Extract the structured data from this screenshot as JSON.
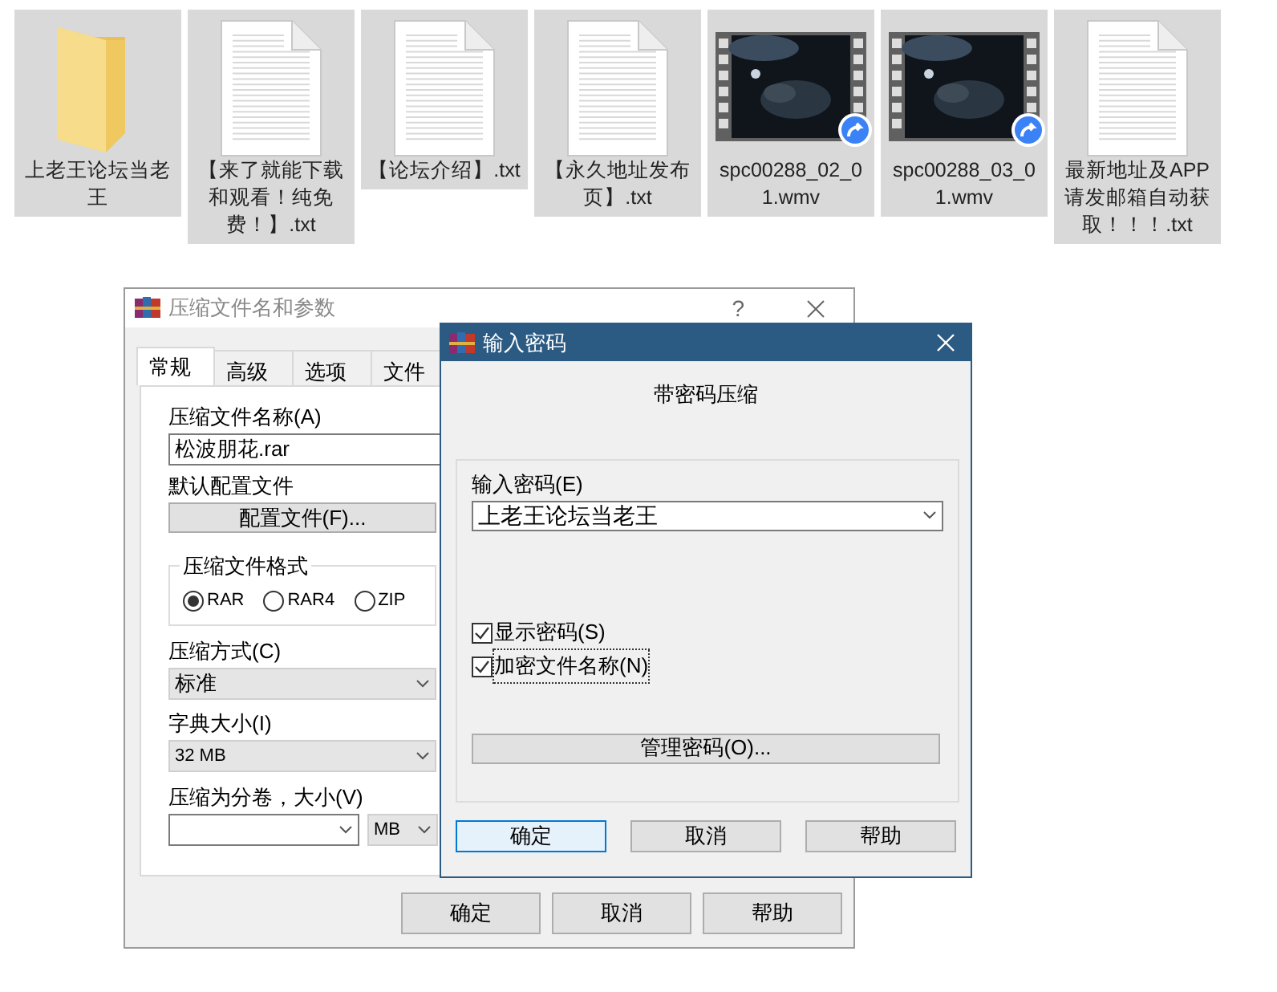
{
  "files": [
    {
      "kind": "folder",
      "name_lines": [
        "上老王论坛当老",
        "王"
      ]
    },
    {
      "kind": "text",
      "name_lines": [
        "【来了就能下载",
        "和观看！纯免",
        "费！】.txt"
      ]
    },
    {
      "kind": "text",
      "name_lines": [
        "【论坛介绍】.txt"
      ]
    },
    {
      "kind": "text",
      "name_lines": [
        "【永久地址发布",
        "页】.txt"
      ]
    },
    {
      "kind": "video",
      "name_lines": [
        "spc00288_02_0",
        "1.wmv"
      ]
    },
    {
      "kind": "video",
      "name_lines": [
        "spc00288_03_0",
        "1.wmv"
      ]
    },
    {
      "kind": "text",
      "name_lines": [
        "最新地址及APP",
        "请发邮箱自动获",
        "取！！！.txt"
      ]
    }
  ],
  "archive_dialog": {
    "title": "压缩文件名和参数",
    "help": "?",
    "tabs": [
      {
        "label": "常规",
        "selected": true
      },
      {
        "label": "高级",
        "selected": false
      },
      {
        "label": "选项",
        "selected": false
      },
      {
        "label": "文件",
        "selected": false
      }
    ],
    "name_label": "压缩文件名称(A)",
    "name_value": "松波朋花.rar",
    "profile_label": "默认配置文件",
    "profile_button": "配置文件(F)...",
    "format_group": "压缩文件格式",
    "formats": [
      {
        "label": "RAR",
        "selected": true
      },
      {
        "label": "RAR4",
        "selected": false
      },
      {
        "label": "ZIP",
        "selected": false
      }
    ],
    "method_label": "压缩方式(C)",
    "method_value": "标准",
    "dict_label": "字典大小(I)",
    "dict_value": "32 MB",
    "volume_label": "压缩为分卷，大小(V)",
    "volume_unit": "MB",
    "buttons": [
      "确定",
      "取消",
      "帮助"
    ]
  },
  "password_dialog": {
    "title": "输入密码",
    "heading": "带密码压缩",
    "password_label": "输入密码(E)",
    "password_value": "上老王论坛当老王",
    "options": [
      {
        "label": "显示密码(S)",
        "checked": true,
        "focused": false
      },
      {
        "label": "加密文件名称(N)",
        "checked": true,
        "focused": true
      }
    ],
    "manage_button": "管理密码(O)...",
    "buttons": [
      {
        "label": "确定",
        "default": true
      },
      {
        "label": "取消",
        "default": false
      },
      {
        "label": "帮助",
        "default": false
      }
    ]
  }
}
